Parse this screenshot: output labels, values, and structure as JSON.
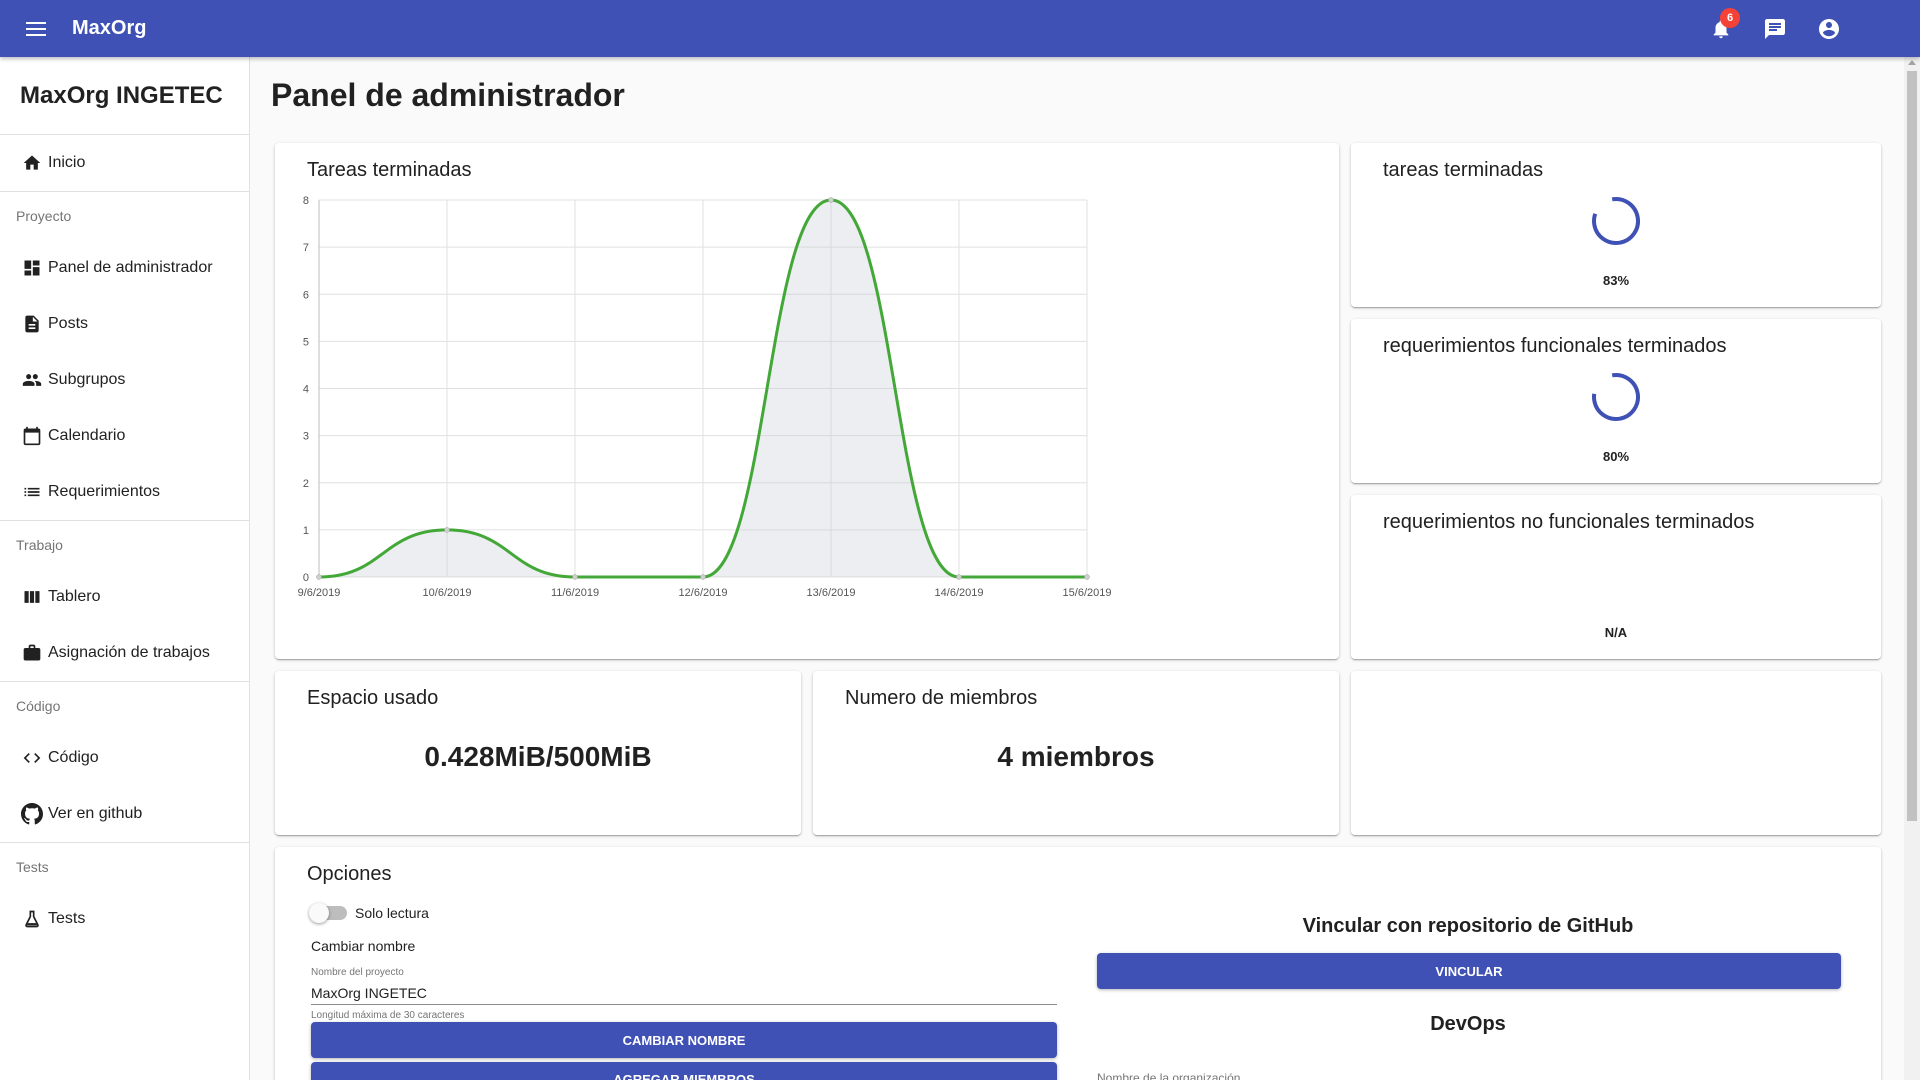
{
  "app": {
    "title": "MaxOrg",
    "notification_count": "6"
  },
  "drawer": {
    "title": "MaxOrg INGETEC",
    "home": {
      "label": "Inicio",
      "icon": "home-icon"
    },
    "sections": [
      {
        "header": "Proyecto",
        "items": [
          {
            "label": "Panel de administrador",
            "icon": "dashboard-icon"
          },
          {
            "label": "Posts",
            "icon": "description-icon"
          },
          {
            "label": "Subgrupos",
            "icon": "people-icon"
          },
          {
            "label": "Calendario",
            "icon": "calendar-icon"
          },
          {
            "label": "Requerimientos",
            "icon": "list-icon"
          }
        ]
      },
      {
        "header": "Trabajo",
        "items": [
          {
            "label": "Tablero",
            "icon": "columns-icon"
          },
          {
            "label": "Asignación de trabajos",
            "icon": "work-icon"
          }
        ]
      },
      {
        "header": "Código",
        "items": [
          {
            "label": "Código",
            "icon": "code-icon"
          },
          {
            "label": "Ver en github",
            "icon": "github-icon"
          }
        ]
      },
      {
        "header": "Tests",
        "items": [
          {
            "label": "Tests",
            "icon": "flask-icon"
          }
        ]
      }
    ]
  },
  "main": {
    "page_title": "Panel de administrador",
    "chart_card": {
      "title": "Tareas terminadas"
    },
    "stats": [
      {
        "title": "tareas terminadas",
        "percent": 83,
        "label": "83%"
      },
      {
        "title": "requerimientos funcionales terminados",
        "percent": 80,
        "label": "80%"
      },
      {
        "title": "requerimientos no funcionales terminados",
        "percent": null,
        "label": "N/A"
      }
    ],
    "space": {
      "title": "Espacio usado",
      "value": "0.428MiB/500MiB"
    },
    "members": {
      "title": "Numero de miembros",
      "value": "4 miembros"
    },
    "options": {
      "title": "Opciones",
      "readonly_label": "Solo lectura",
      "readonly_on": false,
      "rename_label": "Cambiar nombre",
      "name_field_label": "Nombre del proyecto",
      "name_field_value": "MaxOrg INGETEC",
      "name_helper": "Longitud máxima de 30 caracteres",
      "rename_button": "CAMBIAR NOMBRE",
      "add_members_button": "AGREGAR MIEMBROS",
      "github_title": "Vincular con repositorio de GitHub",
      "link_button": "VINCULAR",
      "devops_title": "DevOps",
      "org_label": "Nombre de la organización"
    }
  },
  "colors": {
    "primary": "#3f51b5",
    "chart_line": "#43a838",
    "badge": "#f44336"
  },
  "chart_data": {
    "type": "area",
    "title": "Tareas terminadas",
    "categories": [
      "9/6/2019",
      "10/6/2019",
      "11/6/2019",
      "12/6/2019",
      "13/6/2019",
      "14/6/2019",
      "15/6/2019"
    ],
    "series": [
      {
        "values": [
          0,
          1,
          0,
          0,
          8,
          0,
          0
        ]
      }
    ],
    "ylim": [
      0,
      8
    ],
    "yticks": [
      "0",
      "1",
      "2",
      "3",
      "4",
      "5",
      "6",
      "7",
      "8"
    ],
    "grid": true
  }
}
